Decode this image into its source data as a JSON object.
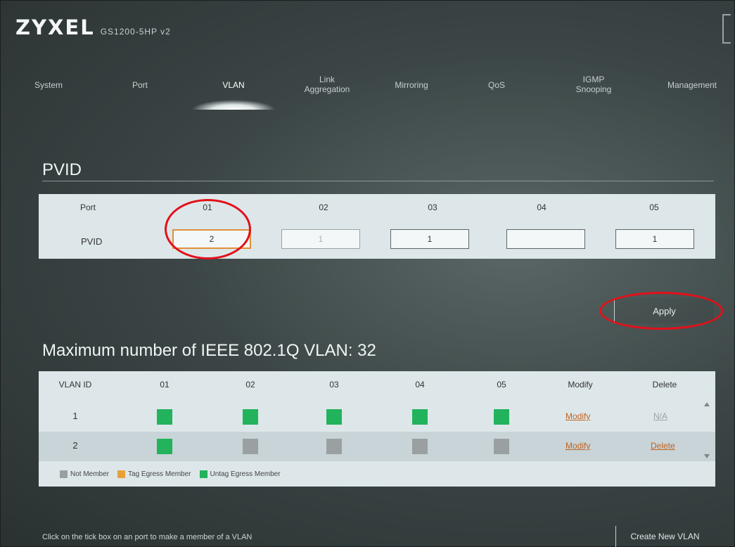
{
  "header": {
    "brand": "ZYXEL",
    "model": "GS1200-5HP v2"
  },
  "nav": {
    "tabs": [
      {
        "label": "System"
      },
      {
        "label": "Port"
      },
      {
        "label": "VLAN",
        "active": true
      },
      {
        "label": "Link Aggregation"
      },
      {
        "label": "Mirroring"
      },
      {
        "label": "QoS"
      },
      {
        "label": "IGMP Snooping"
      },
      {
        "label": "Management"
      }
    ]
  },
  "pvid": {
    "title": "PVID",
    "port_header": "Port",
    "row_label": "PVID",
    "ports": [
      "01",
      "02",
      "03",
      "04",
      "05"
    ],
    "values": [
      "2",
      "1",
      "1",
      "",
      "1"
    ]
  },
  "apply_label": "Apply",
  "vlan": {
    "title": "Maximum number of IEEE 802.1Q VLAN: 32",
    "headers": [
      "VLAN ID",
      "01",
      "02",
      "03",
      "04",
      "05",
      "Modify",
      "Delete"
    ],
    "rows": [
      {
        "id": "1",
        "members": [
          true,
          true,
          true,
          true,
          true
        ],
        "modify": "Modify",
        "delete": "N/A"
      },
      {
        "id": "2",
        "members": [
          true,
          false,
          false,
          false,
          false
        ],
        "modify": "Modify",
        "delete": "Delete"
      }
    ],
    "legend": [
      "Not Member",
      "Tag Egress Member",
      "Untag Egress Member"
    ]
  },
  "hint": "Click on the tick box on an port to make a member of a VLAN",
  "create_label": "Create New VLAN",
  "colors": {
    "member_green": "#22b35c",
    "non_member_gray": "#9aa0a1",
    "tag_orange": "#e6a23a",
    "highlight_red": "#e3101a",
    "panel_bg": "#dde7ea"
  },
  "icons": [
    "logout-icon",
    "scroll-up-icon",
    "scroll-down-icon"
  ]
}
